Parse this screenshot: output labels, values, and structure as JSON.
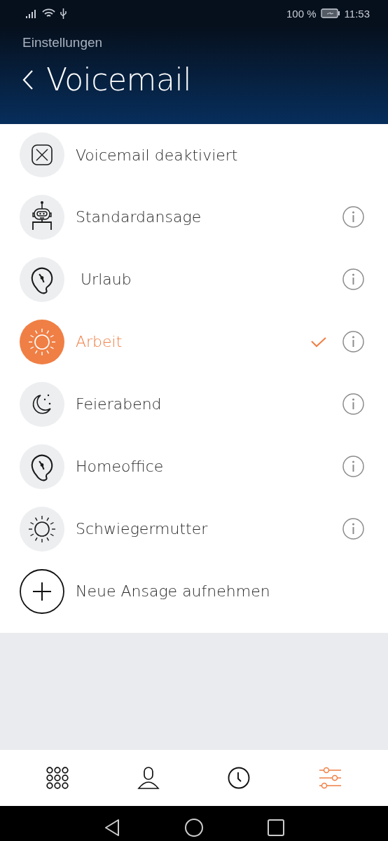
{
  "status_bar": {
    "battery": "100 %",
    "time": "11:53"
  },
  "header": {
    "back_label": "Einstellungen",
    "title": "Voicemail"
  },
  "items": [
    {
      "label": "Voicemail deaktiviert",
      "kind": "disabled",
      "selected": false,
      "info": false
    },
    {
      "label": "Standardansage",
      "kind": "robot",
      "selected": false,
      "info": true
    },
    {
      "label": " Urlaub",
      "kind": "head",
      "selected": false,
      "info": true
    },
    {
      "label": "Arbeit",
      "kind": "sun",
      "selected": true,
      "info": true
    },
    {
      "label": "Feierabend",
      "kind": "moon",
      "selected": false,
      "info": true
    },
    {
      "label": "Homeoffice",
      "kind": "head",
      "selected": false,
      "info": true
    },
    {
      "label": "Schwiegermutter",
      "kind": "sun",
      "selected": false,
      "info": true
    },
    {
      "label": "Neue Ansage aufnehmen",
      "kind": "add",
      "selected": false,
      "info": false
    }
  ],
  "bottom_nav": [
    {
      "kind": "keypad",
      "selected": false
    },
    {
      "kind": "contacts",
      "selected": false
    },
    {
      "kind": "history",
      "selected": false
    },
    {
      "kind": "settings",
      "selected": true
    }
  ]
}
